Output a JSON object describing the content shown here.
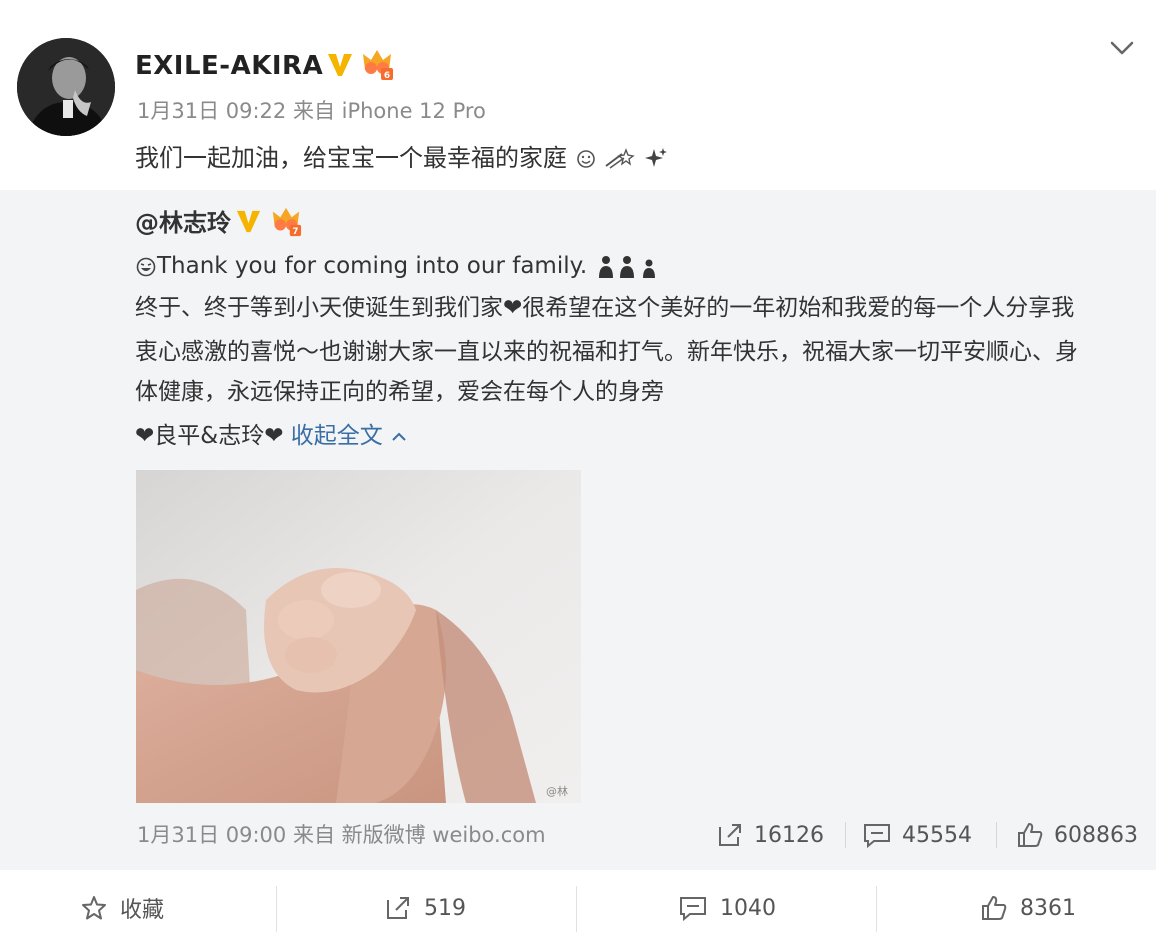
{
  "post": {
    "author": "EXILE-AKIRA",
    "meta": "1月31日 09:22 来自 iPhone 12 Pro",
    "text": "我们一起加油，给宝宝一个最幸福的家庭",
    "icons": {
      "verified": "verified-v-icon",
      "level": "level-badge-icon",
      "more": "chevron-down-icon"
    }
  },
  "repost": {
    "author": "@林志玲",
    "line1": "Thank you for coming into our family.",
    "line2": "终于、终于等到小天使诞生到我们家❤很希望在这个美好的一年初始和我爱的每一个人分享我",
    "line3": "衷心感激的喜悦～也谢谢大家一直以来的祝福和打气。新年快乐，祝福大家一切平安顺心、身",
    "line4": "体健康，永远保持正向的希望，爱会在每个人的身旁",
    "sign": "❤良平&志玲❤",
    "collapse_label": "收起全文",
    "photo_watermark": "@林",
    "meta": "1月31日 09:00 来自 新版微博 weibo.com",
    "stats": {
      "reposts": "16126",
      "comments": "45554",
      "likes": "608863"
    }
  },
  "footer": {
    "favorite": "收藏",
    "reposts": "519",
    "comments": "1040",
    "likes": "8361"
  }
}
